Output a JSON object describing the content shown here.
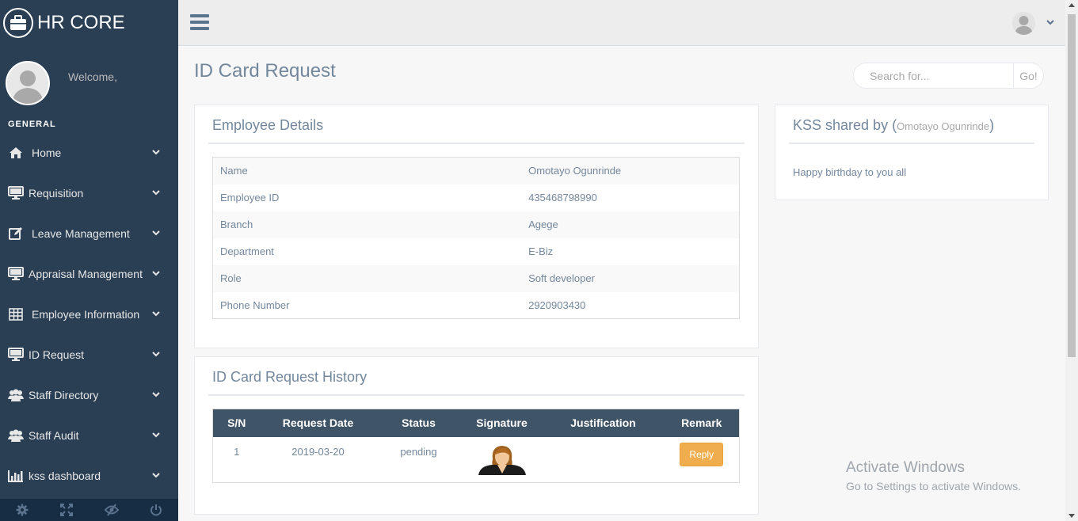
{
  "brand": {
    "title": "HR CORE"
  },
  "profile": {
    "welcome": "Welcome,"
  },
  "sidebar": {
    "section": "GENERAL",
    "items": [
      {
        "label": "Home",
        "icon": "home-icon"
      },
      {
        "label": "Requisition",
        "icon": "desktop-icon"
      },
      {
        "label": "Leave Management",
        "icon": "edit-icon"
      },
      {
        "label": "Appraisal Management",
        "icon": "desktop-icon"
      },
      {
        "label": "Employee Information",
        "icon": "table-icon"
      },
      {
        "label": "ID Request",
        "icon": "desktop-icon"
      },
      {
        "label": "Staff Directory",
        "icon": "users-icon"
      },
      {
        "label": "Staff Audit",
        "icon": "users-icon"
      },
      {
        "label": "kss dashboard",
        "icon": "bar-chart-icon"
      }
    ],
    "footer": [
      "settings-icon",
      "fullscreen-icon",
      "lock-icon",
      "logout-icon"
    ]
  },
  "page": {
    "title": "ID Card Request"
  },
  "search": {
    "placeholder": "Search for...",
    "go": "Go!"
  },
  "employee": {
    "title": "Employee Details",
    "rows": [
      {
        "label": "Name",
        "value": "Omotayo Ogunrinde"
      },
      {
        "label": "Employee ID",
        "value": "435468798990"
      },
      {
        "label": "Branch",
        "value": "Agege"
      },
      {
        "label": "Department",
        "value": "E-Biz"
      },
      {
        "label": "Role",
        "value": "Soft developer"
      },
      {
        "label": "Phone Number",
        "value": "2920903430"
      }
    ]
  },
  "history": {
    "title": "ID Card Request History",
    "columns": [
      "S/N",
      "Request Date",
      "Status",
      "Signature",
      "Justification",
      "Remark"
    ],
    "rows": [
      {
        "sn": "1",
        "date": "2019-03-20",
        "status": "pending",
        "justification": "",
        "remark": "Reply"
      }
    ]
  },
  "kss": {
    "title_prefix": "KSS shared by (",
    "author": "Omotayo Ogunrinde",
    "title_suffix": ")",
    "message": "Happy birthday to you all"
  },
  "watermark": {
    "line1": "Activate Windows",
    "line2": "Go to Settings to activate Windows."
  },
  "colors": {
    "sidebar": "#2a3f54",
    "table_header": "#405467",
    "reply_button": "#f0ad4e"
  }
}
